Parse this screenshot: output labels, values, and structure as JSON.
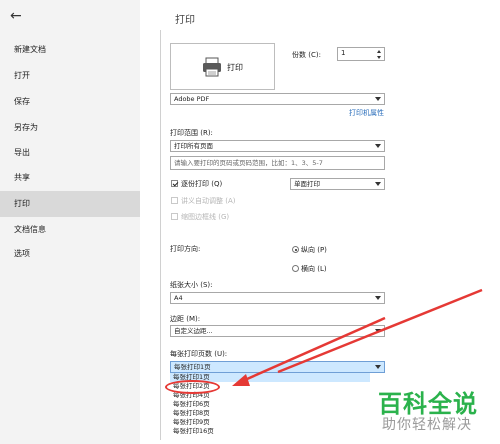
{
  "header": {
    "title": "打印"
  },
  "sidebar": {
    "back_icon": "arrow-left-icon",
    "items": [
      {
        "label": "新建文档"
      },
      {
        "label": "打开"
      },
      {
        "label": "保存"
      },
      {
        "label": "另存为"
      },
      {
        "label": "导出"
      },
      {
        "label": "共享"
      },
      {
        "label": "打印",
        "active": true
      },
      {
        "label": "文档信息"
      },
      {
        "label": "选项"
      }
    ]
  },
  "print": {
    "button_label": "打印",
    "copies_label": "份数 (C):",
    "copies_value": "1",
    "printer_value": "Adobe PDF",
    "printer_props_link": "打印机属性"
  },
  "range": {
    "label": "打印范围 (R):",
    "value": "打印所有页面",
    "pages_placeholder": "请输入要打印的页码或页码范围，比如：1、3、5-7"
  },
  "options": {
    "collate_label": "逐份打印 (Q)",
    "collate_checked": true,
    "sides_value": "单面打印",
    "reverse_label": "讲义自动调整 (A)",
    "gutter_label": "缩图边框线 (G)"
  },
  "orientation": {
    "label": "打印方向:",
    "portrait": "纵向 (P)",
    "landscape": "横向 (L)",
    "selected": "portrait"
  },
  "paper": {
    "label": "纸张大小 (S):",
    "value": "A4"
  },
  "margins": {
    "label": "边距 (M):",
    "value": "自定义边距..."
  },
  "pages_per_sheet": {
    "label": "每张打印页数 (U):",
    "value": "每张打印1页",
    "options": [
      "每张打印1页",
      "每张打印2页",
      "每张打印4页",
      "每张打印6页",
      "每张打印8页",
      "每张打印9页",
      "每张打印16页"
    ]
  },
  "watermark": {
    "brand": "百科全说",
    "slogan": "助你轻松解决"
  },
  "colors": {
    "annotation_red": "#e53935",
    "link_blue": "#2a6ebb",
    "highlight_blue": "#cde8ff",
    "watermark_green": "#2bb24c"
  }
}
